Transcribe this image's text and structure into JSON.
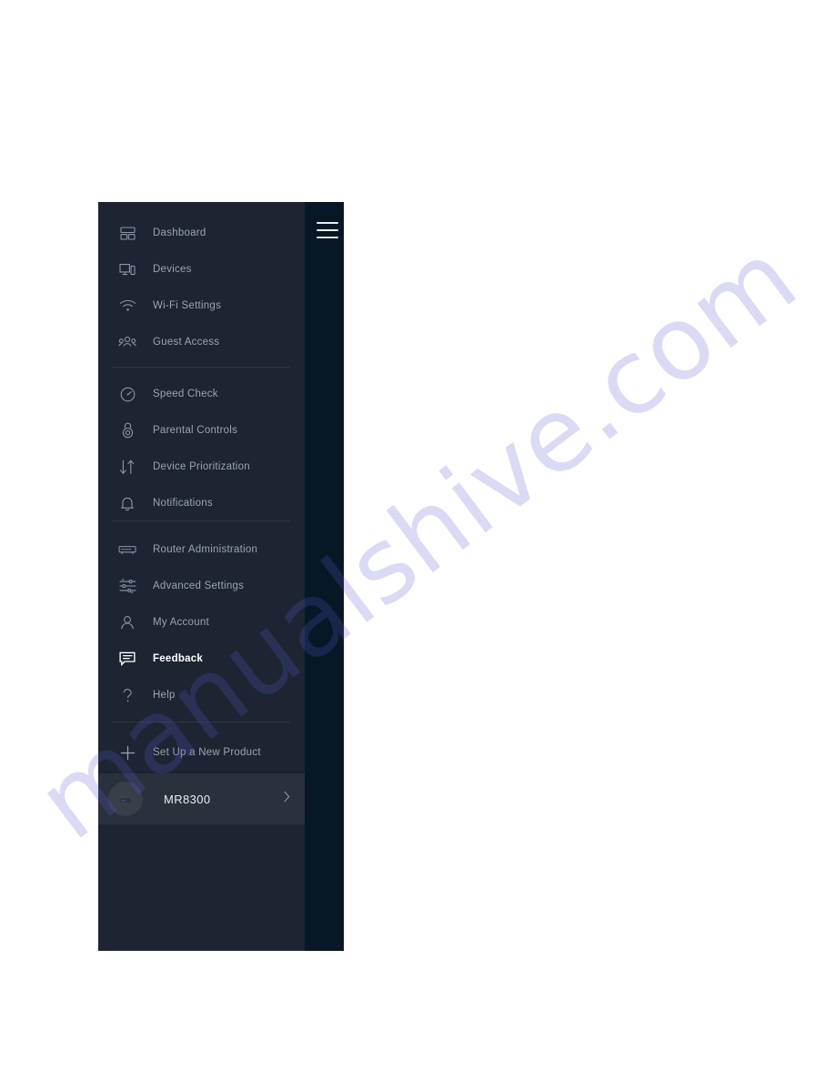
{
  "page": {
    "background_color": "#ffffff",
    "watermark_text": "manualshive.com",
    "watermark_color": "#5a5ad6"
  },
  "screenshot": {
    "drawer_background": "#1e2431",
    "scrim_background": "#081726",
    "accent_active_color": "#ffffff",
    "label_color": "#9aa4b2",
    "hamburger": {
      "name": "menu-toggle"
    },
    "nav_groups": [
      {
        "items": [
          {
            "label": "Dashboard",
            "icon": "dashboard-icon",
            "active": false
          },
          {
            "label": "Devices",
            "icon": "devices-icon",
            "active": false
          },
          {
            "label": "Wi-Fi Settings",
            "icon": "wifi-icon",
            "active": false
          },
          {
            "label": "Guest Access",
            "icon": "guest-access-icon",
            "active": false
          }
        ]
      },
      {
        "items": [
          {
            "label": "Speed Check",
            "icon": "speedometer-icon",
            "active": false
          },
          {
            "label": "Parental Controls",
            "icon": "lock-icon",
            "active": false
          },
          {
            "label": "Device Prioritization",
            "icon": "up-down-arrows-icon",
            "active": false
          },
          {
            "label": "Notifications",
            "icon": "bell-icon",
            "active": false
          }
        ]
      },
      {
        "items": [
          {
            "label": "Router Administration",
            "icon": "router-icon",
            "active": false
          },
          {
            "label": "Advanced Settings",
            "icon": "sliders-icon",
            "active": false
          },
          {
            "label": "My Account",
            "icon": "person-icon",
            "active": false
          },
          {
            "label": "Feedback",
            "icon": "speech-bubble-icon",
            "active": true
          },
          {
            "label": "Help",
            "icon": "question-mark-icon",
            "active": false
          }
        ]
      }
    ],
    "setup_item": {
      "label": "Set Up a New Product",
      "icon": "plus-icon"
    },
    "device_row": {
      "name": "MR8300",
      "avatar_icon": "router-device-icon",
      "chevron_icon": "chevron-right-icon"
    }
  }
}
